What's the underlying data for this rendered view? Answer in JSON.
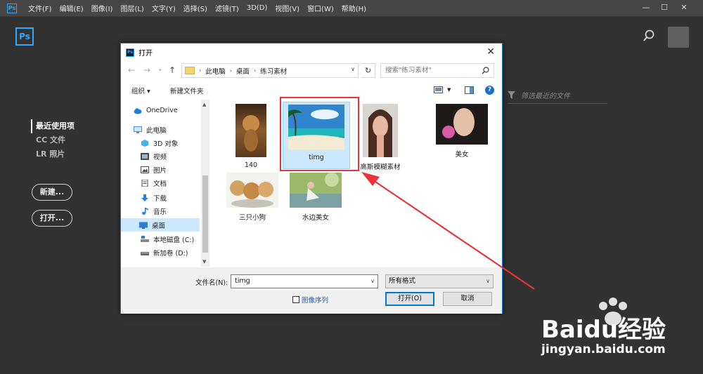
{
  "menubar": {
    "app_icon": "Ps",
    "items": [
      "文件(F)",
      "编辑(E)",
      "图像(I)",
      "图层(L)",
      "文字(Y)",
      "选择(S)",
      "滤镜(T)",
      "3D(D)",
      "视图(V)",
      "窗口(W)",
      "帮助(H)"
    ],
    "minimize": "—",
    "maximize": "☐",
    "close": "✕"
  },
  "home": {
    "logo": "Ps",
    "nav": [
      "最近使用项",
      "CC 文件",
      "LR 照片"
    ],
    "new_button": "新建...",
    "open_button": "打开...",
    "filter_placeholder": "筛选最近的文件"
  },
  "dialog": {
    "icon": "Ps",
    "title": "打开",
    "close": "✕",
    "breadcrumb": [
      "此电脑",
      "桌面",
      "练习素材"
    ],
    "search_placeholder": "搜索\"练习素材\"",
    "organize": "组织 ▾",
    "new_folder": "新建文件夹",
    "sidebar": [
      {
        "label": "OneDrive",
        "icon": "cloud-icon",
        "color": "#1d7fdc"
      },
      {
        "label": "此电脑",
        "icon": "computer-icon",
        "color": "#4a8fd4"
      },
      {
        "label": "3D 对象",
        "icon": "cube-icon",
        "color": "#3fb4e6"
      },
      {
        "label": "视频",
        "icon": "video-icon",
        "color": "#4a4a4a"
      },
      {
        "label": "图片",
        "icon": "picture-icon",
        "color": "#4a4a4a"
      },
      {
        "label": "文档",
        "icon": "document-icon",
        "color": "#4a4a4a"
      },
      {
        "label": "下载",
        "icon": "download-icon",
        "color": "#2d7cd6"
      },
      {
        "label": "音乐",
        "icon": "music-icon",
        "color": "#2d7cd6"
      },
      {
        "label": "桌面",
        "icon": "desktop-icon",
        "color": "#2d7cd6"
      },
      {
        "label": "本地磁盘 (C:)",
        "icon": "disk-icon",
        "color": "#6a6a6a"
      },
      {
        "label": "新加卷 (D:)",
        "icon": "disk-icon",
        "color": "#6a6a6a"
      }
    ],
    "selected_sidebar": "桌面",
    "files": [
      {
        "label": "140",
        "thumb": "lion-photo"
      },
      {
        "label": "timg",
        "thumb": "beach-photo"
      },
      {
        "label": "高斯模糊素材",
        "thumb": "portrait-photo"
      },
      {
        "label": "美女",
        "thumb": "woman-flower-photo"
      },
      {
        "label": "三只小狗",
        "thumb": "puppies-photo"
      },
      {
        "label": "水边美女",
        "thumb": "waterside-photo"
      }
    ],
    "selected_file": "timg",
    "filename_label": "文件名(N):",
    "filename_value": "timg",
    "format_value": "所有格式",
    "image_sequence": "图像序列",
    "open_button": "打开(O)",
    "cancel_button": "取消"
  },
  "watermark": {
    "brand": "Baidu经验",
    "url": "jingyan.baidu.com"
  },
  "colors": {
    "ps_blue": "#31a8ff",
    "highlight_red": "#e8343a",
    "selection_blue": "#cce8ff"
  }
}
